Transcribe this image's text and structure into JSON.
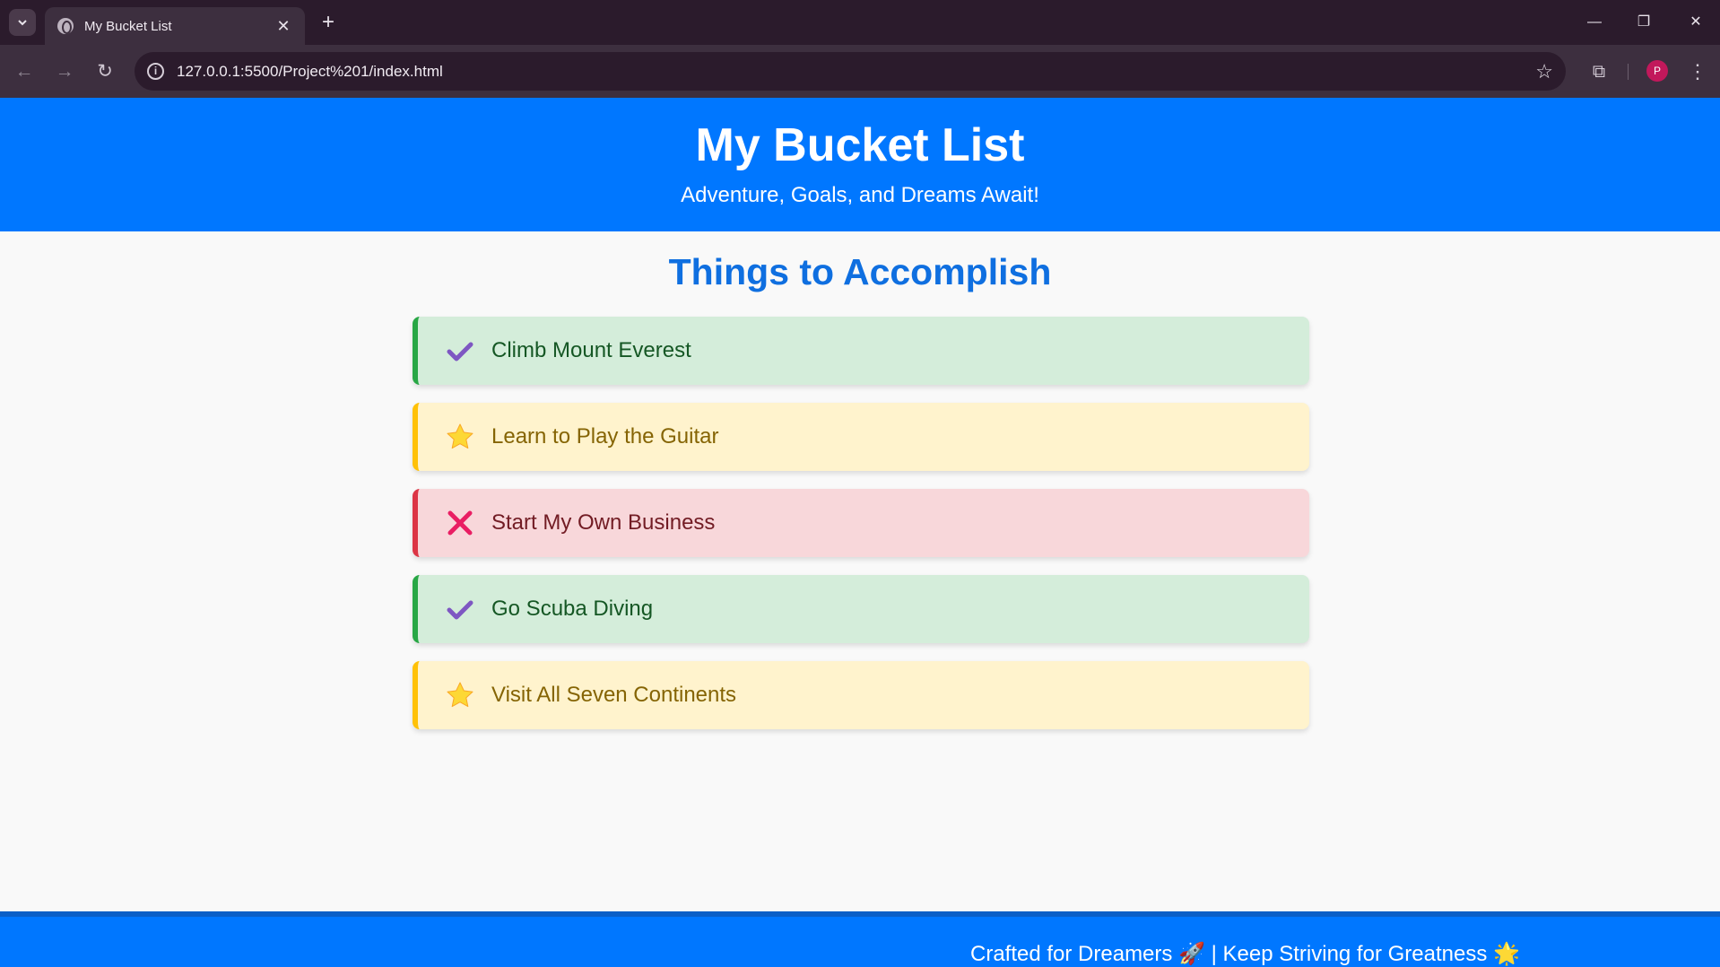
{
  "browser": {
    "tab_title": "My Bucket List",
    "new_tab_label": "+",
    "url": "127.0.0.1:5500/Project%201/index.html",
    "avatar_initial": "P"
  },
  "header": {
    "title": "My Bucket List",
    "subtitle": "Adventure, Goals, and Dreams Await!"
  },
  "main": {
    "section_title": "Things to Accomplish",
    "items": [
      {
        "label": "Climb Mount Everest",
        "status": "done",
        "icon": "check-icon",
        "bg": "#d4edda",
        "border": "#28a745",
        "text": "#155724"
      },
      {
        "label": "Learn to Play the Guitar",
        "status": "in-progress",
        "icon": "star-icon",
        "bg": "#fff3cd",
        "border": "#ffc107",
        "text": "#856404"
      },
      {
        "label": "Start My Own Business",
        "status": "not-done",
        "icon": "cross-icon",
        "bg": "#f8d7da",
        "border": "#dc3545",
        "text": "#721c24"
      },
      {
        "label": "Go Scuba Diving",
        "status": "done",
        "icon": "check-icon",
        "bg": "#d4edda",
        "border": "#28a745",
        "text": "#155724"
      },
      {
        "label": "Visit All Seven Continents",
        "status": "in-progress",
        "icon": "star-icon",
        "bg": "#fff3cd",
        "border": "#ffc107",
        "text": "#856404"
      }
    ]
  },
  "footer": {
    "text": "Crafted for Dreamers 🚀 | Keep Striving for Greatness 🌟"
  },
  "colors": {
    "brand_blue": "#0077ff",
    "section_title": "#0f6fe0",
    "check": "#7e57c2",
    "star": "#fdd835",
    "cross": "#e91e63"
  }
}
